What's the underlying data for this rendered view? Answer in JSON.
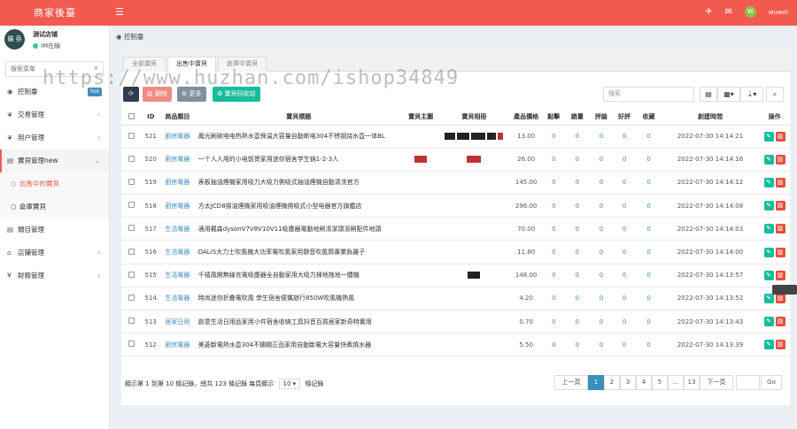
{
  "header": {
    "brand": "商家後臺",
    "user": "wuwei",
    "user_initial": "W"
  },
  "profile": {
    "name": "测试店铺",
    "status": "IM在線",
    "avatar_text": "貓 吞"
  },
  "sidebar": {
    "search_placeholder": "搜索菜单",
    "items": [
      {
        "label": "控制臺",
        "badge": "hot"
      },
      {
        "label": "交易管理"
      },
      {
        "label": "用户管理"
      },
      {
        "label": "寶貝管理new"
      },
      {
        "label": "出售中的寶貝"
      },
      {
        "label": "倉庫寶貝"
      },
      {
        "label": "類目管理"
      },
      {
        "label": "店鋪管理"
      },
      {
        "label": "財務管理"
      }
    ]
  },
  "breadcrumb": "控制臺",
  "tabs": [
    "全部寶貝",
    "出售中寶貝",
    "倉庫中寶貝"
  ],
  "toolbar": {
    "refresh": "⟳",
    "delete": "删除",
    "more": "更多",
    "recycle": "寶貝回收站",
    "search_placeholder": "搜索"
  },
  "table": {
    "headers": [
      "",
      "ID",
      "商品類目",
      "寶貝標題",
      "寶貝主圖",
      "寶貝相冊",
      "產品價格",
      "點擊",
      "銷量",
      "評論",
      "好評",
      "收藏",
      "創建時間",
      "操作"
    ],
    "rows": [
      {
        "id": "521",
        "cat": "廚房電器",
        "title": "鳳光刷碗电电热熱水壺保温大容量自動断电304不锈钢烧水壺一体BL",
        "price": "13.00",
        "clicks": "0",
        "sales": "0",
        "comments": "0",
        "good": "0",
        "fav": "0",
        "time": "2022-07-30 14:14:21"
      },
      {
        "id": "520",
        "cat": "廚房電器",
        "title": "一个人人用的小电饭煲家用迷你宿舍学生锅1-2-3人",
        "price": "26.00",
        "clicks": "0",
        "sales": "0",
        "comments": "0",
        "good": "0",
        "fav": "0",
        "time": "2022-07-30 14:14:16"
      },
      {
        "id": "519",
        "cat": "廚房電器",
        "title": "表板抽油煙機家用吸力大吸力側吸式抽油煙機自動清洗官方",
        "price": "145.00",
        "clicks": "0",
        "sales": "0",
        "comments": "0",
        "good": "0",
        "fav": "0",
        "time": "2022-07-30 14:14:12"
      },
      {
        "id": "518",
        "cat": "廚房電器",
        "title": "方太JCD8揚油煙機家用吸油煙機側吸式小型电器官方旗艦店",
        "price": "296.00",
        "clicks": "0",
        "sales": "0",
        "comments": "0",
        "good": "0",
        "fav": "0",
        "time": "2022-07-30 14:14:08"
      },
      {
        "id": "517",
        "cat": "生活電器",
        "title": "適用戴森dysonV7V8V10V11吸塵器電動地刷清潔頭滾刷配件地頭",
        "price": "70.00",
        "clicks": "0",
        "sales": "0",
        "comments": "0",
        "good": "0",
        "fav": "0",
        "time": "2022-07-30 14:14:03"
      },
      {
        "id": "516",
        "cat": "生活電器",
        "title": "DALIS大力士吹風機大功率電吹風家用靜音吹風筒專業負離子",
        "price": "11.80",
        "clicks": "0",
        "sales": "0",
        "comments": "0",
        "good": "0",
        "fav": "0",
        "time": "2022-07-30 14:14:00"
      },
      {
        "id": "515",
        "cat": "生活電器",
        "title": "千禧風開無線充電吸塵器全自動家用大吸力掃地拖地一體機",
        "price": "148.00",
        "clicks": "0",
        "sales": "0",
        "comments": "0",
        "good": "0",
        "fav": "0",
        "time": "2022-07-30 14:13:57"
      },
      {
        "id": "514",
        "cat": "生活電器",
        "title": "時尚迷你折疊電吹風 學生宿舍便攜旅行850W吹風機熱風",
        "price": "4.20",
        "clicks": "0",
        "sales": "0",
        "comments": "0",
        "good": "0",
        "fav": "0",
        "time": "2022-07-30 14:13:52"
      },
      {
        "id": "513",
        "cat": "居家日用",
        "title": "創意生活日用品家用小件宿舍收納工具抖音百貨居家新奇特實用",
        "price": "0.70",
        "clicks": "0",
        "sales": "0",
        "comments": "0",
        "good": "0",
        "fav": "0",
        "time": "2022-07-30 14:13:43"
      },
      {
        "id": "512",
        "cat": "廚房電器",
        "title": "美菱斷電熱水壺304不鏽鋼正品家用自動斷電大容量快煮燒水器",
        "price": "5.50",
        "clicks": "0",
        "sales": "0",
        "comments": "0",
        "good": "0",
        "fav": "0",
        "time": "2022-07-30 14:13:39"
      }
    ]
  },
  "pagination": {
    "info_prefix": "顯示第 1 到第 10 條記錄，總共 123 條記錄 每頁顯示",
    "per_page": "10",
    "info_suffix": "條記錄",
    "prev": "上一頁",
    "pages": [
      "1",
      "2",
      "3",
      "4",
      "5",
      "...",
      "13"
    ],
    "next": "下一頁",
    "go": "Go"
  },
  "watermark": "https://www.huzhan.com/ishop34849",
  "colors": {
    "accent": "#f25a4f",
    "link": "#3c8dbc",
    "edit": "#18bc9c",
    "delete": "#e74c3c"
  }
}
